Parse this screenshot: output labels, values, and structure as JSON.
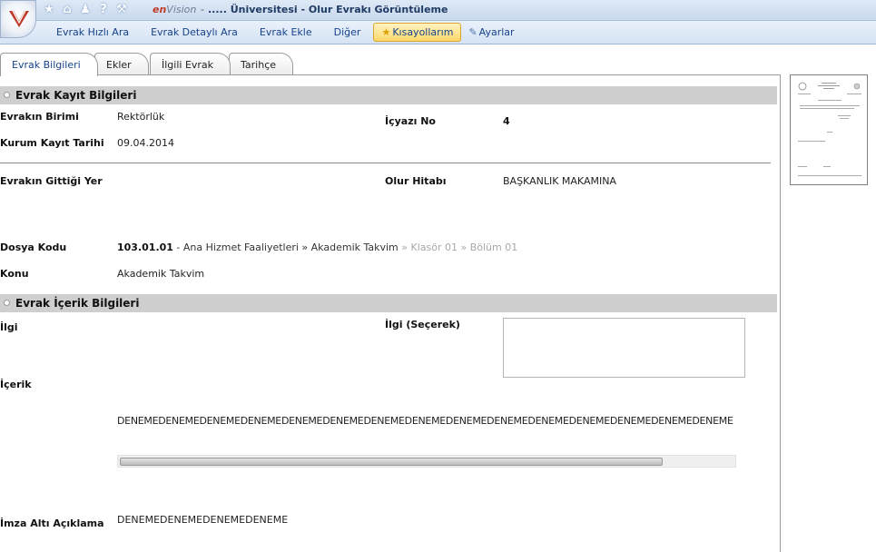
{
  "title_bar": {
    "brand": "enVision",
    "separator": "-",
    "window_title": "..... Üniversitesi - Olur Evrakı Görüntüleme"
  },
  "menu": {
    "items": [
      "Evrak Hızlı Ara",
      "Evrak Detaylı Ara",
      "Evrak Ekle",
      "Diğer"
    ],
    "shortcuts_label": "Kısayollarım",
    "settings_label": "Ayarlar"
  },
  "tabs": [
    "Evrak Bilgileri",
    "Ekler",
    "İlgili Evrak",
    "Tarihçe"
  ],
  "active_tab": "Evrak Bilgileri",
  "kayit": {
    "section_title": "Evrak Kayıt Bilgileri",
    "birim_label": "Evrakın Birimi",
    "birim_value": "Rektörlük",
    "icyazi_label": "İçyazı No",
    "icyazi_value": "4",
    "tarih_label": "Kurum Kayıt Tarihi",
    "tarih_value": "09.04.2014",
    "gittigi_label": "Evrakın Gittiği Yer",
    "olur_label": "Olur Hitabı",
    "olur_value": "BAŞKANLIK MAKAMINA",
    "dosya_label": "Dosya Kodu",
    "dosya_code": "103.01.01",
    "dosya_path_1": " - Ana Hizmet Faaliyetleri » Akademik Takvim",
    "dosya_path_2": " » Klasör 01 » Bölüm 01",
    "konu_label": "Konu",
    "konu_value": "Akademik Takvim"
  },
  "icerik": {
    "section_title": "Evrak İçerik Bilgileri",
    "ilgi_label": "İlgi",
    "ilgi_secerek_label": "İlgi (Seçerek)",
    "icerik_label": "İçerik",
    "icerik_value": "DENEMEDENEMEDENEMEDENEMEDENEMEDENEMEDENEMEDENEMEDENEMEDENEMEDENEMEDENEMEDENEMEDENEMEDENEME",
    "imza_label": "İmza Altı Açıklama",
    "imza_value": "DENEMEDENEMEDENEMEDENEME"
  },
  "colors": {
    "accent": "#15428b",
    "section_bg": "#cfcfcf",
    "highlight": "#ffd86a"
  },
  "icons": [
    "logo-icon",
    "star-icon",
    "home-icon",
    "user-icon",
    "help-icon",
    "tools-icon",
    "shortcut-star-icon",
    "settings-icon"
  ]
}
